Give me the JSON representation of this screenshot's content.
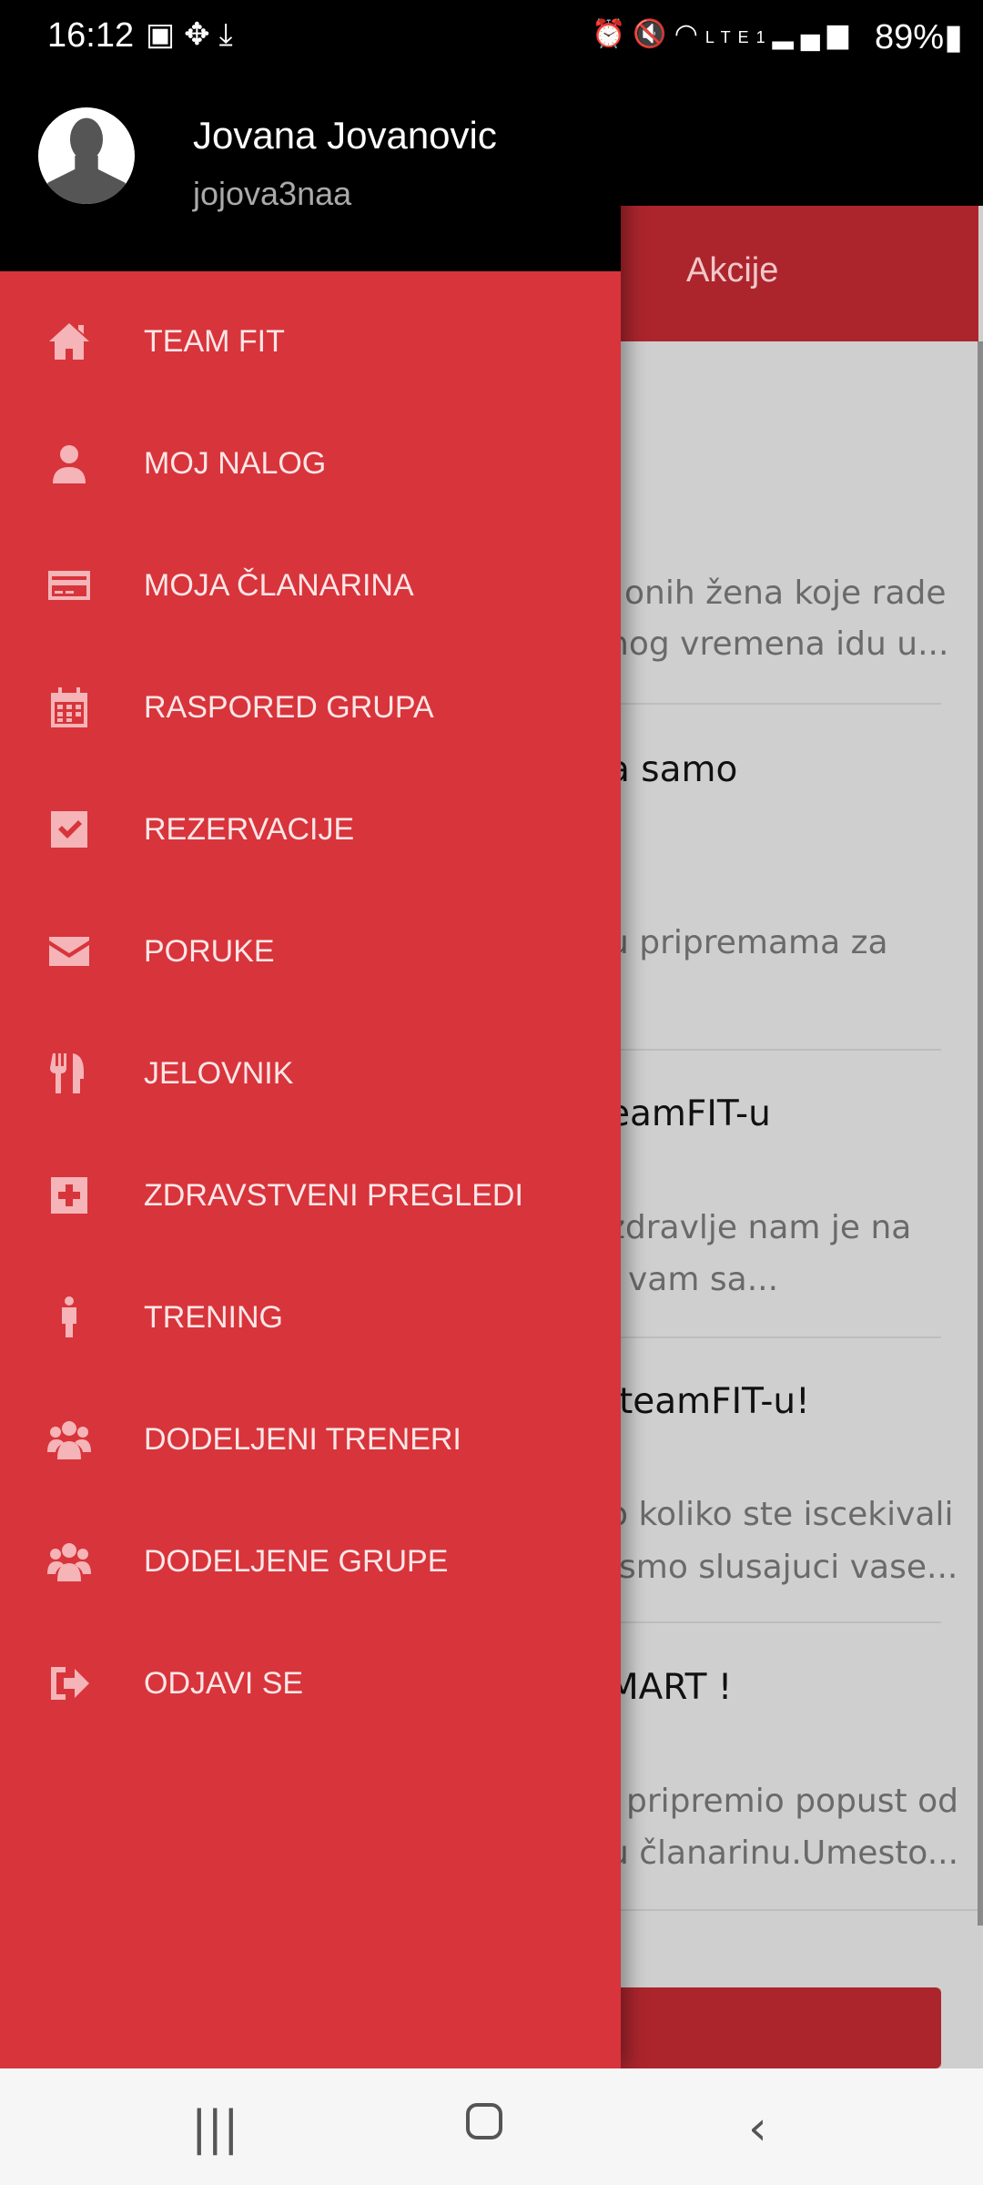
{
  "status_bar": {
    "time": "16:12",
    "battery": "89%",
    "network": "LTE1",
    "left_icons": [
      "image-icon",
      "slack-icon",
      "download-icon"
    ],
    "right_icons": [
      "alarm-icon",
      "mute-icon",
      "wifi-icon",
      "signal-icon",
      "battery-charging-icon"
    ]
  },
  "background": {
    "tab": "Akcije",
    "lines": [
      {
        "text": "onih žena koje rade",
        "kind": "body"
      },
      {
        "text": "nog vremena idu u...",
        "kind": "body"
      },
      {
        "text": "a samo",
        "kind": "title"
      },
      {
        "text": "u pripremama za",
        "kind": "body"
      },
      {
        "text": "eamFIT-u",
        "kind": "title"
      },
      {
        "text": "zdravlje nam je na",
        "kind": "body"
      },
      {
        "text": "vam sa...",
        "kind": "body"
      },
      {
        "text": "teamFIT-u!",
        "kind": "title"
      },
      {
        "text": "o koliko ste iscekivali",
        "kind": "body"
      },
      {
        "text": "smo slusajuci vase...",
        "kind": "body"
      },
      {
        "text": "MART !",
        "kind": "title"
      },
      {
        "text": "pripremio popust od",
        "kind": "body"
      },
      {
        "text": "u članarinu.Umesto...",
        "kind": "body"
      }
    ]
  },
  "drawer": {
    "user": {
      "name": "Jovana Jovanovic",
      "username": "jojova3naa"
    },
    "items": [
      {
        "label": "TEAM FIT",
        "icon": "home-icon"
      },
      {
        "label": "MOJ NALOG",
        "icon": "user-icon"
      },
      {
        "label": "MOJA ČLANARINA",
        "icon": "credit-card-icon"
      },
      {
        "label": "RASPORED GRUPA",
        "icon": "calendar-icon"
      },
      {
        "label": "REZERVACIJE",
        "icon": "check-square-icon"
      },
      {
        "label": "PORUKE",
        "icon": "envelope-icon"
      },
      {
        "label": "JELOVNIK",
        "icon": "utensils-icon"
      },
      {
        "label": "ZDRAVSTVENI PREGLEDI",
        "icon": "medical-plus-icon"
      },
      {
        "label": "TRENING",
        "icon": "person-icon"
      },
      {
        "label": "DODELJENI TRENERI",
        "icon": "users-icon"
      },
      {
        "label": "DODELJENE GRUPE",
        "icon": "users-icon"
      },
      {
        "label": "ODJAVI SE",
        "icon": "sign-out-icon"
      }
    ],
    "colors": {
      "drawer": "#d8343b",
      "header": "#000000",
      "icon": "#f5b4b7"
    }
  }
}
